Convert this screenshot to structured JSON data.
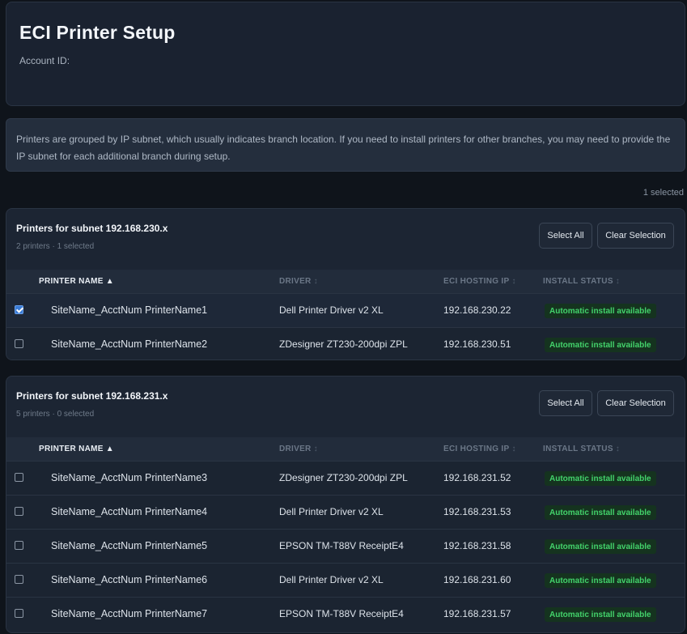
{
  "header": {
    "title": "ECI Printer Setup",
    "account_label": "Account ID:"
  },
  "info_text": "Printers are grouped by IP subnet, which usually indicates branch location. If you need to install printers for other branches, you may need to provide the IP subnet for each additional branch during setup.",
  "selected_total": "1 selected",
  "columns": {
    "name": "PRINTER NAME",
    "driver": "DRIVER",
    "ip": "ECI HOSTING IP",
    "status": "INSTALL STATUS"
  },
  "sort_icons": {
    "active": "sort-asc-icon",
    "inactive": "sort-icon"
  },
  "colors": {
    "accent": "#3a7bd5",
    "status_green": "#43d36b",
    "background": "#0f141b"
  },
  "groups": [
    {
      "title": "Printers for subnet 192.168.230.x",
      "summary": "2 printers · 1 selected",
      "select_all_label": "Select All",
      "clear_label": "Clear Selection",
      "rows": [
        {
          "checked": true,
          "name": "SiteName_AcctNum PrinterName1",
          "driver": "Dell Printer Driver v2 XL",
          "ip": "192.168.230.22",
          "status": "Automatic install available"
        },
        {
          "checked": false,
          "name": "SiteName_AcctNum PrinterName2",
          "driver": "ZDesigner ZT230-200dpi ZPL",
          "ip": "192.168.230.51",
          "status": "Automatic install available"
        }
      ]
    },
    {
      "title": "Printers for subnet 192.168.231.x",
      "summary": "5 printers · 0 selected",
      "select_all_label": "Select All",
      "clear_label": "Clear Selection",
      "rows": [
        {
          "checked": false,
          "name": "SiteName_AcctNum PrinterName3",
          "driver": "ZDesigner ZT230-200dpi ZPL",
          "ip": "192.168.231.52",
          "status": "Automatic install available"
        },
        {
          "checked": false,
          "name": "SiteName_AcctNum PrinterName4",
          "driver": "Dell Printer Driver v2 XL",
          "ip": "192.168.231.53",
          "status": "Automatic install available"
        },
        {
          "checked": false,
          "name": "SiteName_AcctNum PrinterName5",
          "driver": "EPSON TM-T88V ReceiptE4",
          "ip": "192.168.231.58",
          "status": "Automatic install available"
        },
        {
          "checked": false,
          "name": "SiteName_AcctNum PrinterName6",
          "driver": "Dell Printer Driver v2 XL",
          "ip": "192.168.231.60",
          "status": "Automatic install available"
        },
        {
          "checked": false,
          "name": "SiteName_AcctNum PrinterName7",
          "driver": "EPSON TM-T88V ReceiptE4",
          "ip": "192.168.231.57",
          "status": "Automatic install available"
        }
      ]
    }
  ]
}
